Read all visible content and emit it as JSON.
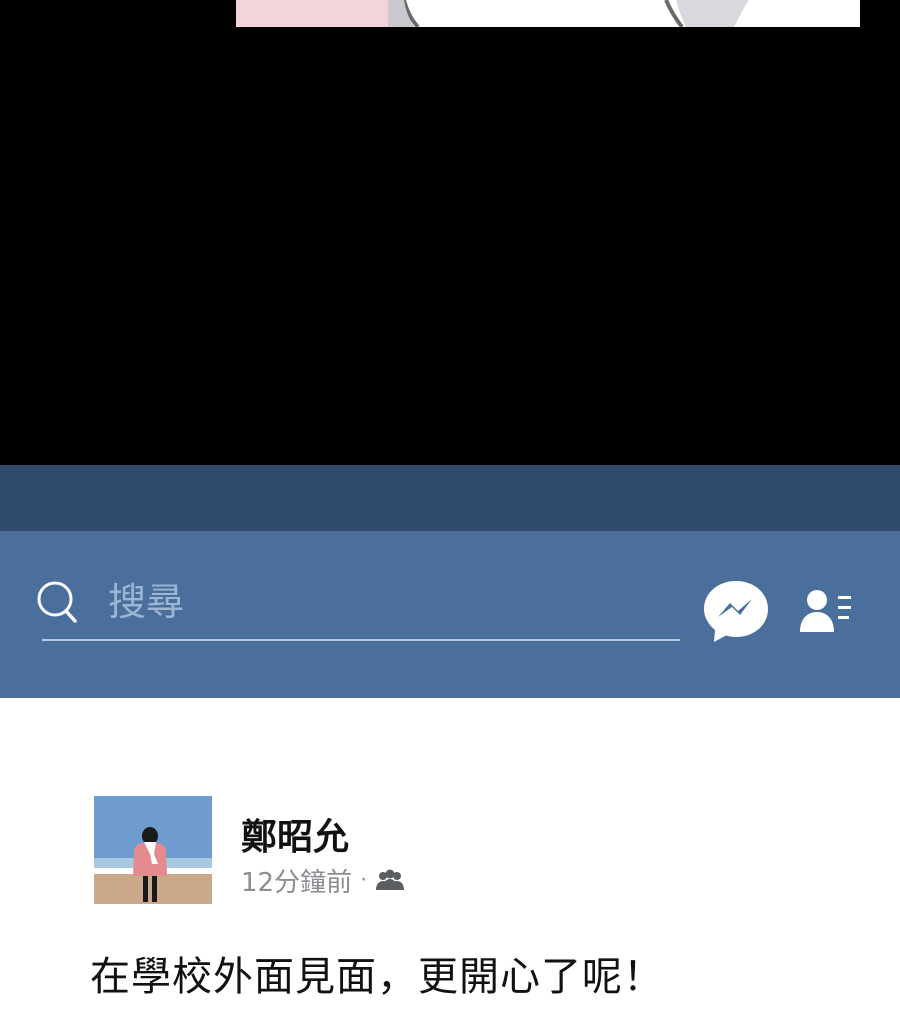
{
  "search": {
    "placeholder": "搜尋"
  },
  "icons": {
    "search": "search-icon",
    "messenger": "messenger-icon",
    "friends": "friend-requests-icon",
    "audience": "friends-audience-icon"
  },
  "post": {
    "author": "鄭昭允",
    "time": "12分鐘前",
    "separator": "·",
    "text": "在學校外面見面，更開心了呢！"
  },
  "colors": {
    "status_bar": "#2e4b6c",
    "search_bar": "#4a6f9c",
    "placeholder": "#9cb6d4",
    "background": "#ffffff"
  }
}
